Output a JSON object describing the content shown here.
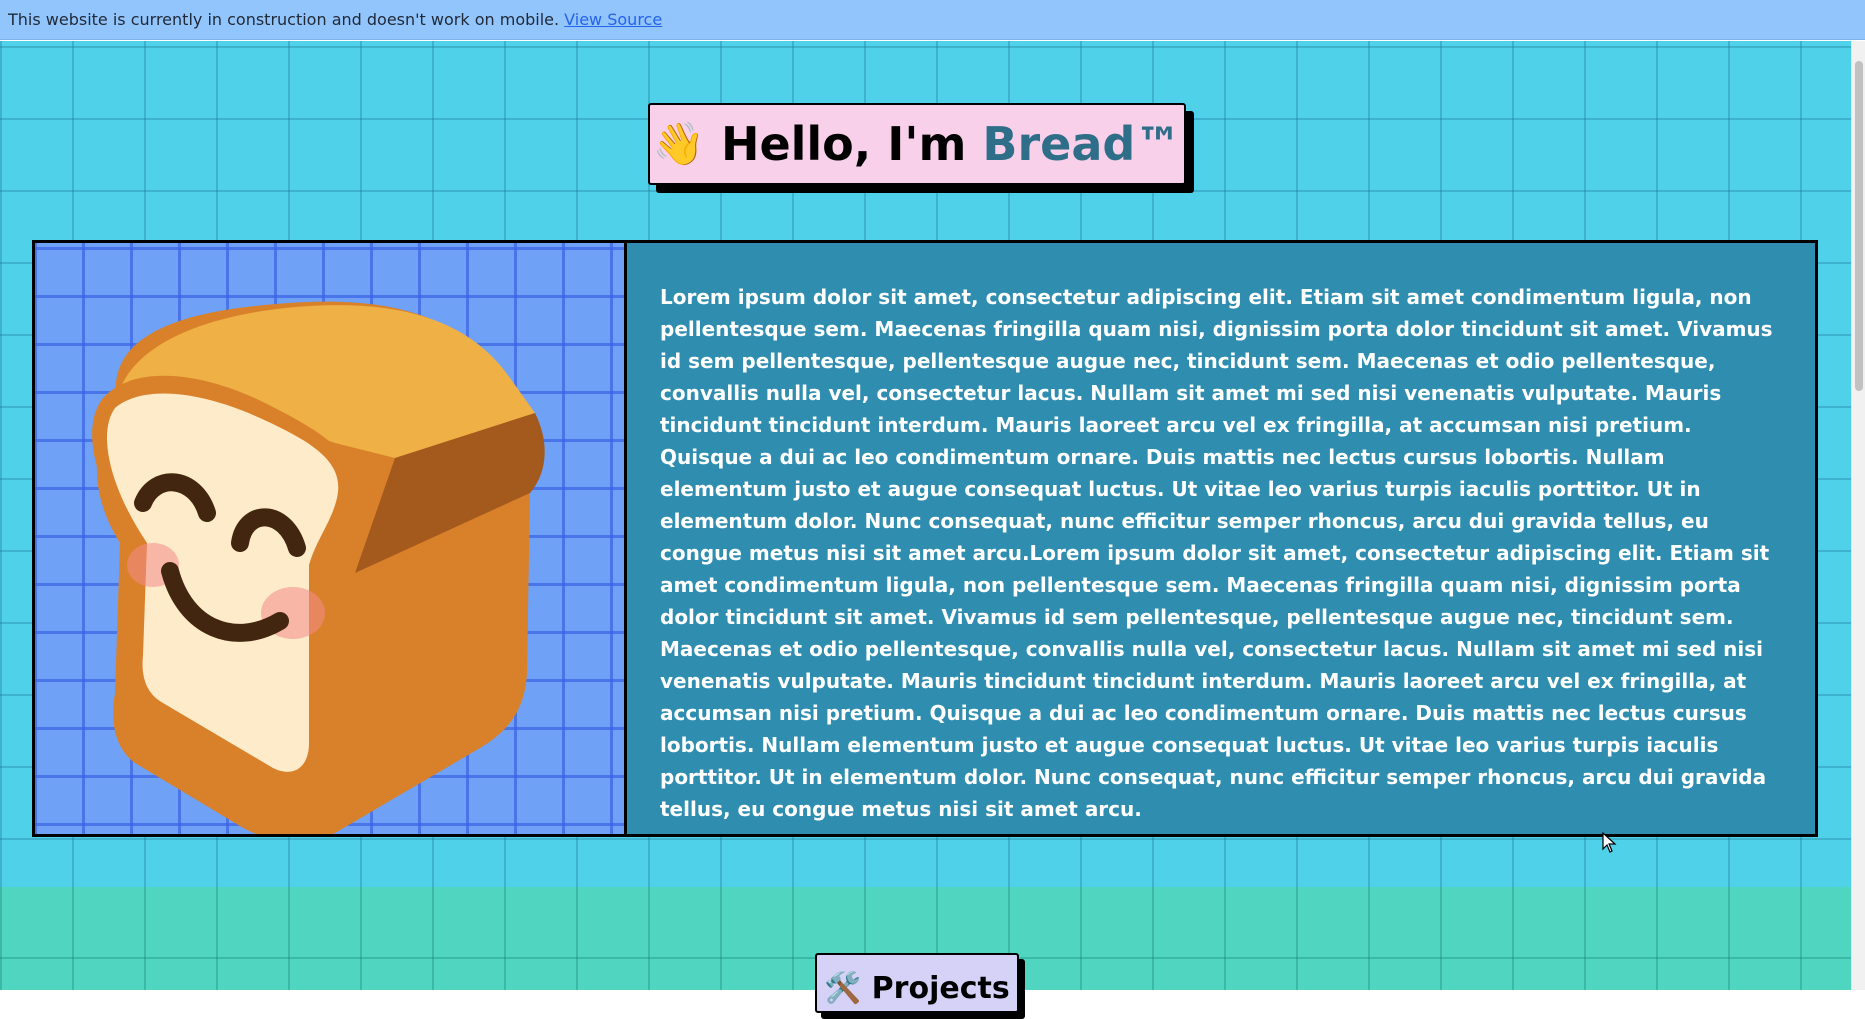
{
  "banner": {
    "message": "This website is currently in construction and doesn't work on mobile.",
    "link_label": "View Source"
  },
  "hero": {
    "greeting_prefix": "Hello, I'm ",
    "name": "Bread™",
    "wave_emoji": "👋",
    "image_icon": "bread-mascot-icon",
    "bio": "Lorem ipsum dolor sit amet, consectetur adipiscing elit. Etiam sit amet condimentum ligula, non pellentesque sem. Maecenas fringilla quam nisi, dignissim porta dolor tincidunt sit amet. Vivamus id sem pellentesque, pellentesque augue nec, tincidunt sem. Maecenas et odio pellentesque, convallis nulla vel, consectetur lacus. Nullam sit amet mi sed nisi venenatis vulputate. Mauris tincidunt tincidunt interdum. Mauris laoreet arcu vel ex fringilla, at accumsan nisi pretium. Quisque a dui ac leo condimentum ornare. Duis mattis nec lectus cursus lobortis. Nullam elementum justo et augue consequat luctus. Ut vitae leo varius turpis iaculis porttitor. Ut in elementum dolor. Nunc consequat, nunc efficitur semper rhoncus, arcu dui gravida tellus, eu congue metus nisi sit amet arcu.Lorem ipsum dolor sit amet, consectetur adipiscing elit. Etiam sit amet condimentum ligula, non pellentesque sem. Maecenas fringilla quam nisi, dignissim porta dolor tincidunt sit amet. Vivamus id sem pellentesque, pellentesque augue nec, tincidunt sem. Maecenas et odio pellentesque, convallis nulla vel, consectetur lacus. Nullam sit amet mi sed nisi venenatis vulputate. Mauris tincidunt tincidunt interdum. Mauris laoreet arcu vel ex fringilla, at accumsan nisi pretium. Quisque a dui ac leo condimentum ornare. Duis mattis nec lectus cursus lobortis. Nullam elementum justo et augue consequat luctus. Ut vitae leo varius turpis iaculis porttitor. Ut in elementum dolor. Nunc consequat, nunc efficitur semper rhoncus, arcu dui gravida tellus, eu congue metus nisi sit amet arcu."
  },
  "projects": {
    "emoji": "🛠️",
    "title": "Projects"
  },
  "colors": {
    "banner_bg": "#93c5fd",
    "hero_bg": "#4fd1ea",
    "title_bg": "#f9d0ea",
    "brand_text": "#2f6e88",
    "card_text_bg": "#2f8eb0",
    "image_bg": "#6fa2f7",
    "projects_section_bg": "#50d5c0",
    "projects_title_bg": "#d6d2f7"
  }
}
